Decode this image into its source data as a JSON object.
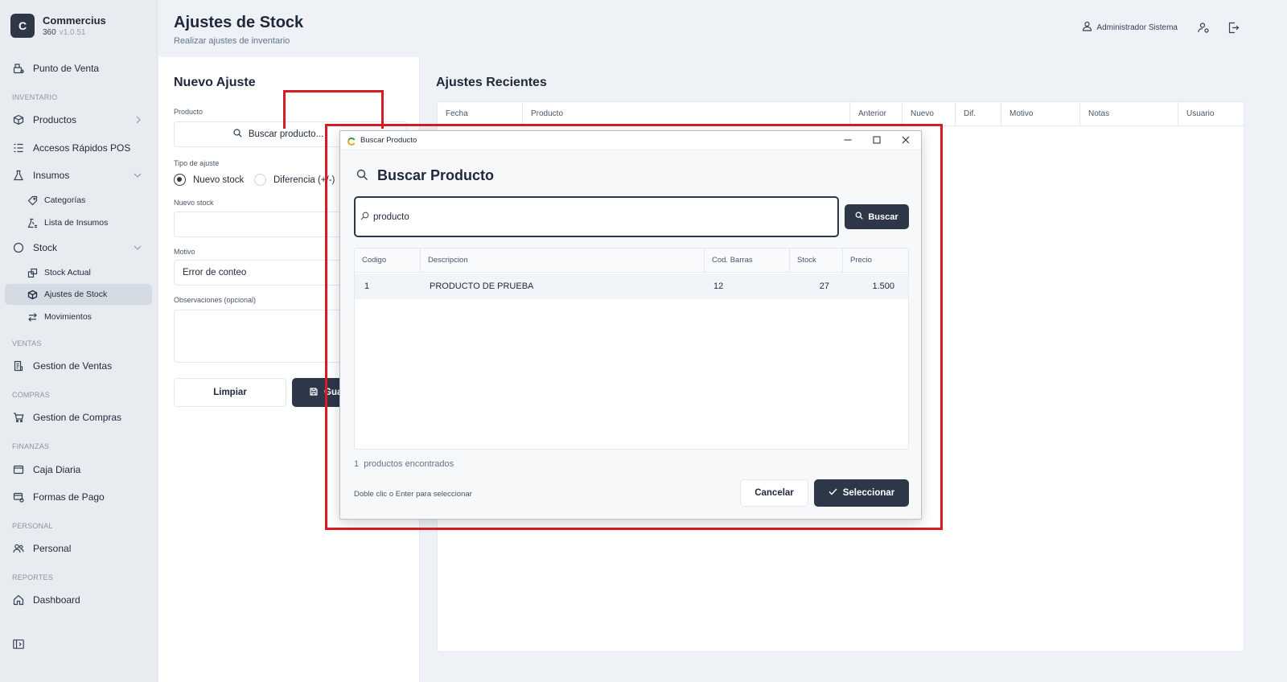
{
  "brand": {
    "letter": "C",
    "name": "Commercius",
    "edition": "360",
    "version": "v1.0.51"
  },
  "sidebar": {
    "pos": "Punto de Venta",
    "sections": {
      "inventario": "INVENTARIO",
      "ventas": "VENTAS",
      "compras": "COMPRAS",
      "finanzas": "FINANZAS",
      "personal": "PERSONAL",
      "reportes": "REPORTES"
    },
    "items": {
      "productos": "Productos",
      "accesos": "Accesos Rápidos POS",
      "insumos": "Insumos",
      "categorias": "Categorías",
      "lista_insumos": "Lista de Insumos",
      "stock": "Stock",
      "stock_actual": "Stock Actual",
      "ajustes_stock": "Ajustes de Stock",
      "movimientos": "Movimientos",
      "gestion_ventas": "Gestion de Ventas",
      "gestion_compras": "Gestion de Compras",
      "caja_diaria": "Caja Diaria",
      "formas_pago": "Formas de Pago",
      "personal": "Personal",
      "dashboard": "Dashboard"
    }
  },
  "header": {
    "title": "Ajustes de Stock",
    "subtitle": "Realizar ajustes de inventario",
    "user": "Administrador Sistema"
  },
  "form": {
    "title": "Nuevo Ajuste",
    "producto_label": "Producto",
    "producto_button": "Buscar producto...",
    "tipo_label": "Tipo de ajuste",
    "tipo_nuevo": "Nuevo stock",
    "tipo_diferencia": "Diferencia (+/-)",
    "nuevo_stock_label": "Nuevo stock",
    "motivo_label": "Motivo",
    "motivo_value": "Error de conteo",
    "observaciones_label": "Observaciones (opcional)",
    "limpiar": "Limpiar",
    "guardar": "Guardar"
  },
  "recent": {
    "title": "Ajustes Recientes",
    "columns": [
      "Fecha",
      "Producto",
      "Anterior",
      "Nuevo",
      "Dif.",
      "Motivo",
      "Notas",
      "Usuario"
    ]
  },
  "modal": {
    "window_title": "Buscar Producto",
    "title": "Buscar Producto",
    "search_value": "producto",
    "search_button": "Buscar",
    "columns": [
      "Codigo",
      "Descripcion",
      "Cod. Barras",
      "Stock",
      "Precio"
    ],
    "rows": [
      {
        "codigo": "1",
        "descripcion": "PRODUCTO DE PRUEBA",
        "cod_barras": "12",
        "stock": "27",
        "precio": "1.500"
      }
    ],
    "count_num": "1",
    "count_text": "productos encontrados",
    "hint": "Doble clic o Enter para seleccionar",
    "cancel": "Cancelar",
    "select": "Seleccionar"
  }
}
